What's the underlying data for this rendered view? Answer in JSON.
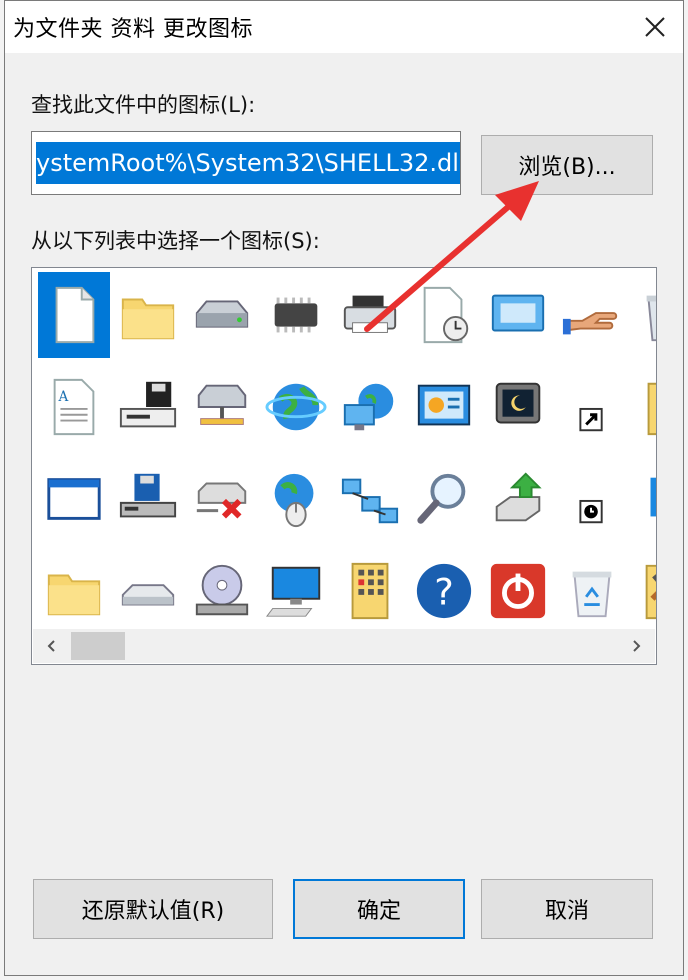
{
  "dialog": {
    "title": "为文件夹 资料 更改图标",
    "close_icon": "close-icon"
  },
  "search": {
    "label": "查找此文件中的图标(L):",
    "path_value": "ystemRoot%\\System32\\SHELL32.dll",
    "browse_label": "浏览(B)..."
  },
  "icon_list": {
    "label": "从以下列表中选择一个图标(S):",
    "selected_index": 0,
    "icons": [
      "blank-document-icon",
      "folder-icon",
      "hard-drive-icon",
      "memory-chip-icon",
      "printer-icon",
      "document-clock-icon",
      "screen-window-icon",
      "sharing-hand-icon",
      "recycle-bin-full-icon",
      "text-document-icon",
      "drive-with-floppy-icon",
      "network-drive-icon",
      "globe-icon",
      "network-globe-monitor-icon",
      "presentation-icon",
      "monitor-moon-icon",
      "shortcut-arrow-icon",
      "folder-key-icon",
      "blank-window-icon",
      "floppy-drive-icon",
      "disconnected-drive-icon",
      "globe-mouse-icon",
      "network-connections-icon",
      "search-magnifier-icon",
      "usb-drive-arrow-icon",
      "clock-overlay-icon",
      "blue-tile-icon",
      "folder-icon-2",
      "flat-drive-icon",
      "cd-drive-icon",
      "computer-monitor-icon",
      "folder-grid-icon",
      "help-question-icon",
      "power-button-icon",
      "recycle-bin-empty-icon",
      "tools-folder-icon"
    ],
    "scroll_left_icon": "chevron-left-icon",
    "scroll_right_icon": "chevron-right-icon"
  },
  "footer": {
    "restore_label": "还原默认值(R)",
    "ok_label": "确定",
    "cancel_label": "取消"
  },
  "colors": {
    "accent": "#0078d7",
    "annotation_arrow": "#e8312f"
  }
}
